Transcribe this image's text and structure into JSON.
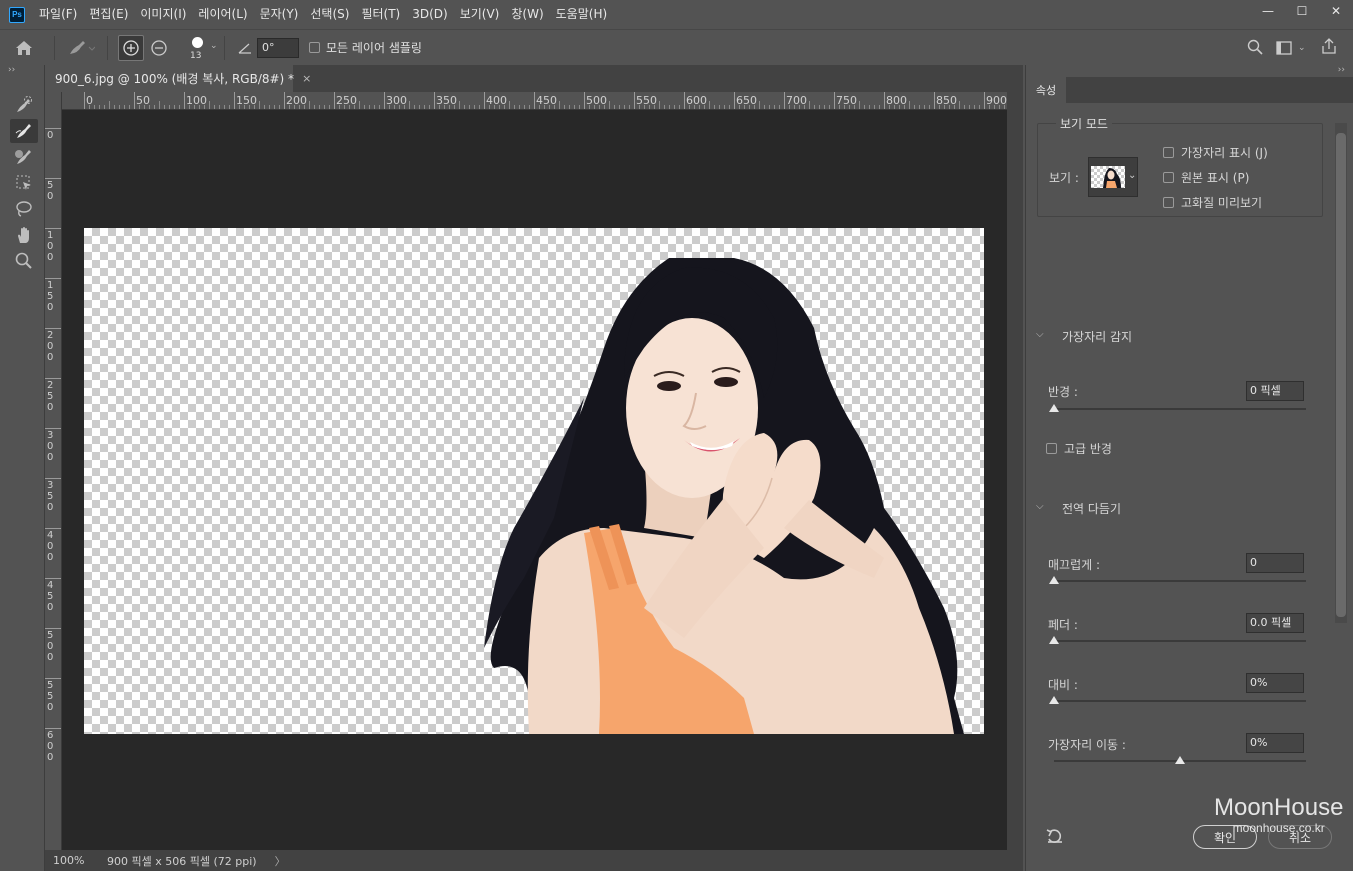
{
  "app": {
    "logo": "Ps"
  },
  "menu": [
    "파일(F)",
    "편집(E)",
    "이미지(I)",
    "레이어(L)",
    "문자(Y)",
    "선택(S)",
    "필터(T)",
    "3D(D)",
    "보기(V)",
    "창(W)",
    "도움말(H)"
  ],
  "window_controls": {
    "minimize": "—",
    "maximize": "☐",
    "close": "✕"
  },
  "options": {
    "brush_size": "13",
    "angle_value": "0°",
    "sample_all_label": "모든 레이어 샘플링"
  },
  "document": {
    "tab_title": "900_6.jpg @ 100% (배경 복사, RGB/8#) *",
    "tab_close": "×",
    "ruler_top": [
      "0",
      "50",
      "100",
      "150",
      "200",
      "250",
      "300",
      "350",
      "400",
      "450",
      "500",
      "550",
      "600",
      "650",
      "700",
      "750",
      "800",
      "850",
      "900"
    ],
    "ruler_left": [
      "0",
      "5 0",
      "1 0 0",
      "1 5 0",
      "2 0 0",
      "2 5 0",
      "3 0 0",
      "3 5 0",
      "4 0 0",
      "4 5 0",
      "5 0 0",
      "5 5 0",
      "6 0 0"
    ]
  },
  "status": {
    "zoom": "100%",
    "info": "900 픽셀 x 506 픽셀 (72 ppi)",
    "arrow": "〉"
  },
  "panel": {
    "tab": "속성",
    "view_mode": {
      "title": "보기 모드",
      "view_label": "보기 :",
      "options": [
        {
          "label": "가장자리 표시 (J)",
          "checked": false
        },
        {
          "label": "원본 표시 (P)",
          "checked": false
        },
        {
          "label": "고화질 미리보기",
          "checked": false
        }
      ]
    },
    "edge_detection": {
      "title": "가장자리 감지",
      "radius_label": "반경 :",
      "radius_value": "0 픽셀",
      "radius_level": 0,
      "smart_radius_label": "고급 반경"
    },
    "global_refinements": {
      "title": "전역 다듬기",
      "smooth_label": "매끄럽게 :",
      "smooth_value": "0",
      "smooth_level": 0,
      "feather_label": "페더 :",
      "feather_value": "0.0 픽셀",
      "feather_level": 0,
      "contrast_label": "대비 :",
      "contrast_value": "0%",
      "contrast_level": 0,
      "shift_label": "가장자리 이동 :",
      "shift_value": "0%",
      "shift_level": 0.5
    },
    "ok_button": "확인",
    "cancel_button": "취소"
  },
  "watermark": {
    "line1": "MoonHouse",
    "line2": "moonhouse.co.kr"
  },
  "colors": {
    "ui_bg": "#535353",
    "pasteboard": "#282828",
    "accent": "#31a8ff",
    "dress": "#f4a06a",
    "hair": "#14141c",
    "skin": "#f5dccb"
  }
}
